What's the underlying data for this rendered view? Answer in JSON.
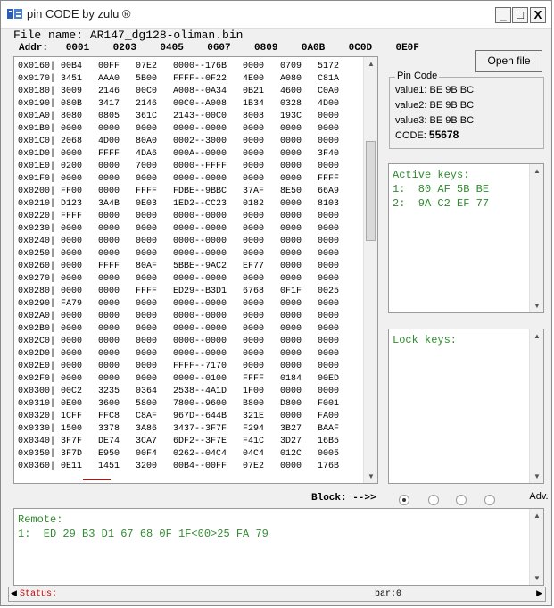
{
  "window": {
    "title": "pin CODE by zulu ®"
  },
  "titlebar_buttons": {
    "minimize": "_",
    "maximize": "□",
    "close": "X"
  },
  "file": {
    "label": "File name: AR147_dg128-oliman.bin"
  },
  "hex": {
    "header": "Addr:   0001    0203    0405    0607    0809    0A0B    0C0D    0E0F",
    "rows": [
      "0x0160| 00B4   00FF   07E2   0000--176B   0000   0709   5172",
      "0x0170| 3451   AAA0   5B00   FFFF--0F22   4E00   A080   C81A",
      "0x0180| 3009   2146   00C0   A008--0A34   0B21   4600   C0A0",
      "0x0190| 080B   3417   2146   00C0--A008   1B34   0328   4D00",
      "0x01A0| 8080   0805   361C   2143--00C0   8008   193C   0000",
      "0x01B0| 0000   0000   0000   0000--0000   0000   0000   0000",
      "0x01C0| 2068   4D00   80A0   0002--3000   0000   0000   0000",
      "0x01D0| 0000   FFFF   4DA6   000A--0000   0000   0000   3F40",
      "0x01E0| 0200   0000   7000   0000--FFFF   0000   0000   0000",
      "0x01F0| 0000   0000   0000   0000--0000   0000   0000   FFFF",
      "0x0200| FF00   0000   FFFF   FDBE--9BBC   37AF   8E50   66A9",
      "0x0210| D123   3A4B   0E03   1ED2--CC23   0182   0000   8103",
      "0x0220| FFFF   0000   0000   0000--0000   0000   0000   0000",
      "0x0230| 0000   0000   0000   0000--0000   0000   0000   0000",
      "0x0240| 0000   0000   0000   0000--0000   0000   0000   0000",
      "0x0250| 0000   0000   0000   0000--0000   0000   0000   0000",
      "0x0260| 0000   FFFF   80AF   5BBE--9AC2   EF77   0000   0000",
      "0x0270| 0000   0000   0000   0000--0000   0000   0000   0000",
      "0x0280| 0000   0000   FFFF   ED29--B3D1   6768   0F1F   0025",
      "0x0290| FA79   0000   0000   0000--0000   0000   0000   0000",
      "0x02A0| 0000   0000   0000   0000--0000   0000   0000   0000",
      "0x02B0| 0000   0000   0000   0000--0000   0000   0000   0000",
      "0x02C0| 0000   0000   0000   0000--0000   0000   0000   0000",
      "0x02D0| 0000   0000   0000   0000--0000   0000   0000   0000",
      "0x02E0| 0000   0000   0000   FFFF--7170   0000   0000   0000",
      "0x02F0| 0000   0000   0000   0000--0100   FFFF   0184   00ED",
      "0x0300| 00C2   3235   0364   2538--4A1D   1F00   0000   0000",
      "0x0310| 0E00   3600   5800   7800--9600   B800   D800   F001",
      "0x0320| 1CFF   FFC8   C8AF   967D--644B   321E   0000   FA00",
      "0x0330| 1500   3378   3A86   3437--3F7F   F294   3B27   BAAF",
      "0x0340| 3F7F   DE74   3CA7   6DF2--3F7E   F41C   3D27   16B5",
      "0x0350| 3F7D   E950   00F4   0262--04C4   04C4   012C   0005",
      "0x0360| 0E11   1451   3200   00B4--00FF   07E2   0000   176B"
    ]
  },
  "buttons": {
    "open_file": "Open file",
    "adv": "Adv."
  },
  "pin_code": {
    "title": "Pin Code",
    "value1": "value1: BE 9B BC",
    "value2": "value2: BE 9B BC",
    "value3": "value3: BE 9B BC",
    "code_label": "CODE: ",
    "code_value": "55678"
  },
  "active_keys": {
    "text": "Active keys:\n1:  80 AF 5B BE\n2:  9A C2 EF 77"
  },
  "lock_keys": {
    "text": "Lock keys:"
  },
  "block": {
    "label": "Block: -->>",
    "selected_index": 0,
    "count": 4
  },
  "remote": {
    "text": "Remote:\n1:  ED 29 B3 D1 67 68 0F 1F<00>25 FA 79"
  },
  "status": {
    "label": "Status:",
    "bar": "bar:0"
  },
  "colors": {
    "key_text": "#2e8b2e",
    "status_text": "#cc0000"
  }
}
